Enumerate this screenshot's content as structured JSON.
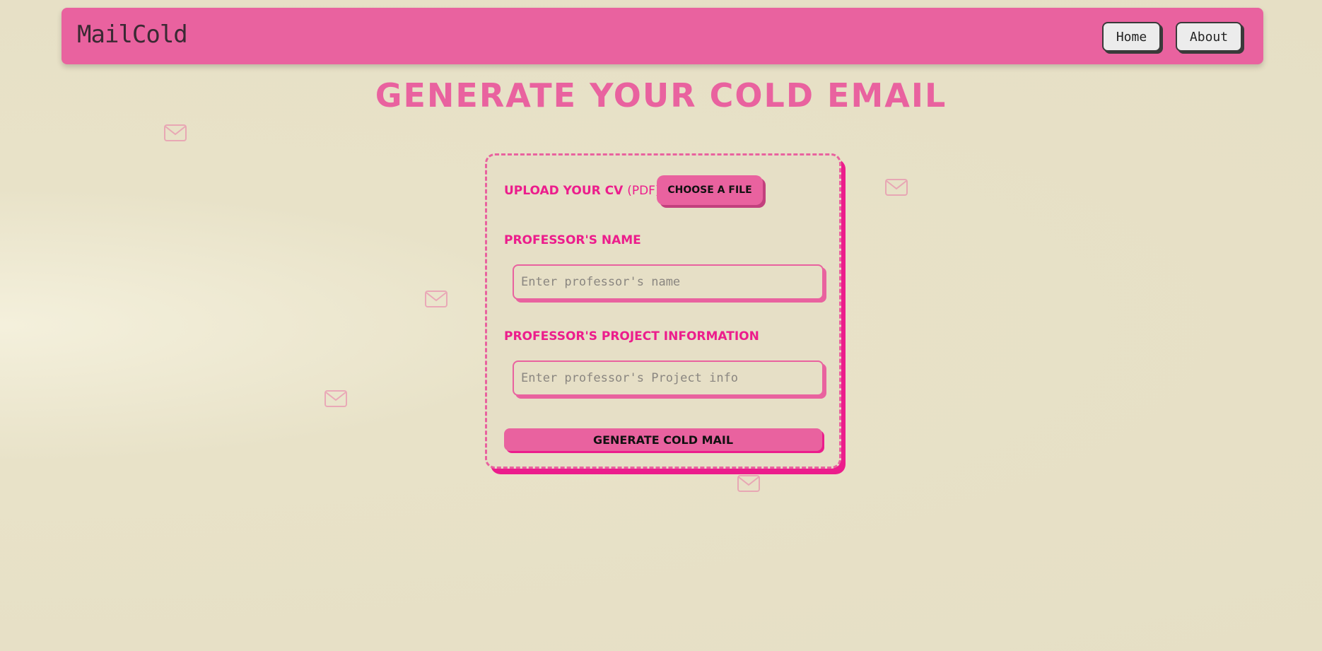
{
  "navbar": {
    "brand": "MailCold",
    "links": [
      {
        "label": "Home"
      },
      {
        "label": "About"
      }
    ]
  },
  "main": {
    "title": "GENERATE YOUR COLD EMAIL"
  },
  "form": {
    "upload_label": "UPLOAD YOUR CV",
    "upload_hint": "(PDF)",
    "file_button": "CHOOSE A FILE",
    "name_label": "PROFESSOR'S NAME",
    "name_placeholder": "Enter professor's name",
    "project_label": "PROFESSOR'S PROJECT INFORMATION",
    "project_placeholder": "Enter professor's Project info",
    "submit": "GENERATE COLD MAIL"
  },
  "decor": {
    "icon": "envelope-icon",
    "colors": {
      "accent": "#e9629f",
      "accent_dark": "#ec1d8c",
      "background": "#e6dfc6",
      "text_dark": "#3a2a33"
    }
  }
}
